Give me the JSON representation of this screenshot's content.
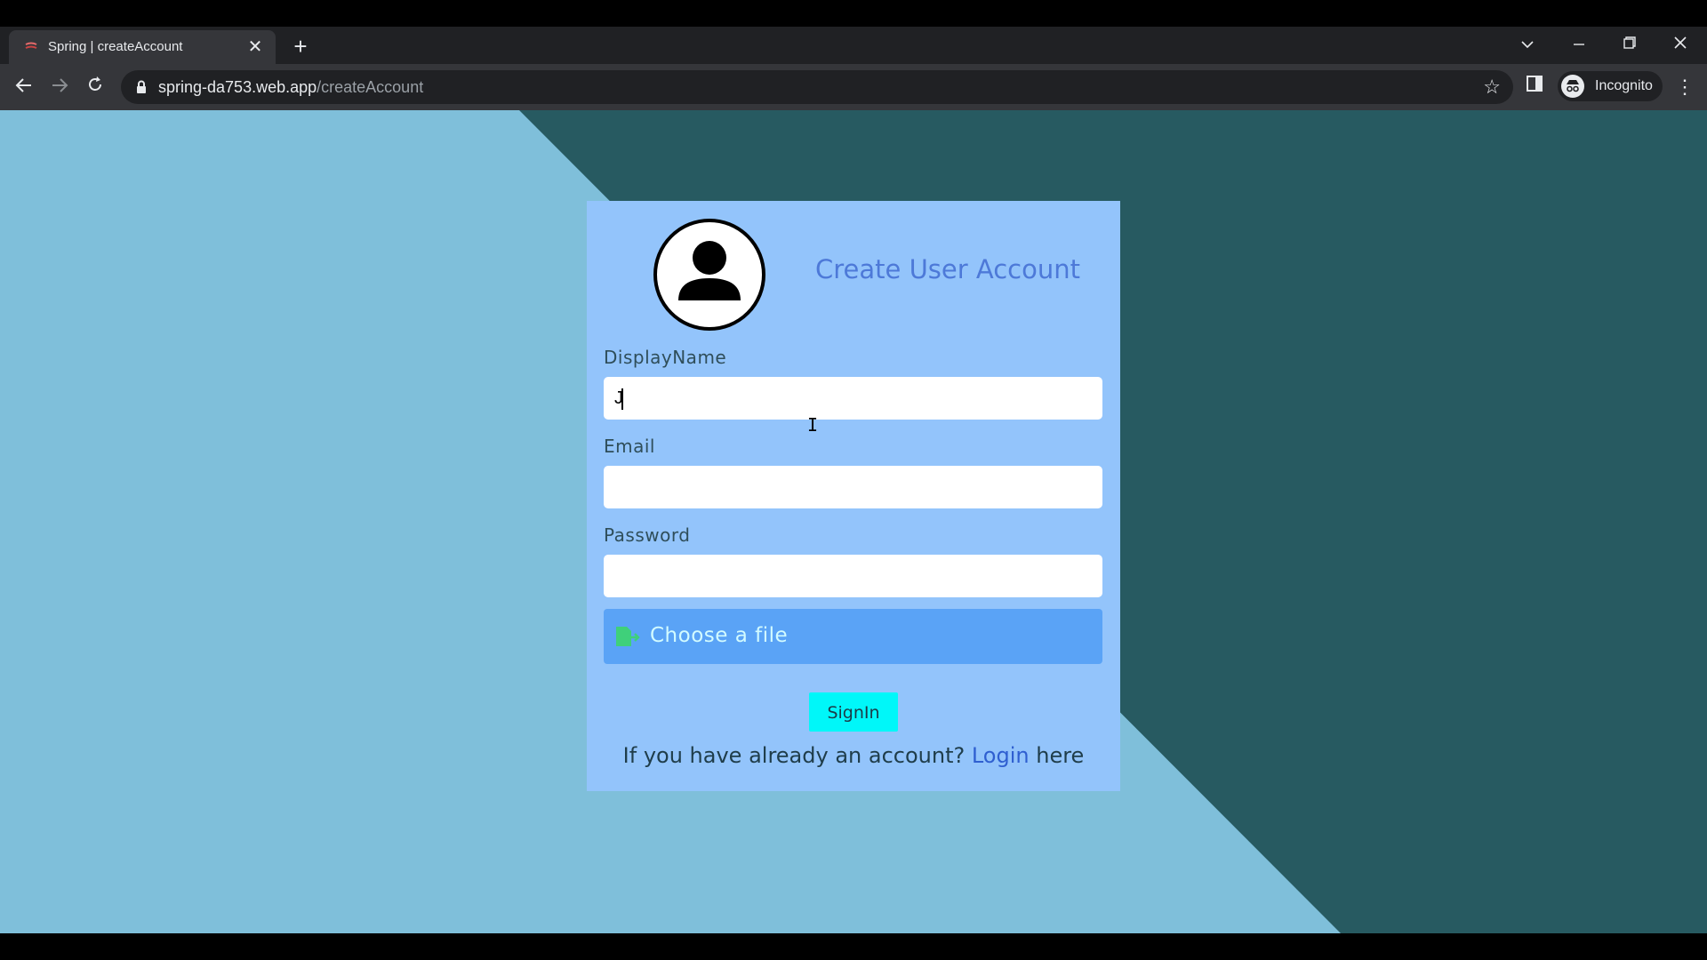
{
  "browser": {
    "tab_title": "Spring | createAccount",
    "url_host": "spring-da753.web.app",
    "url_path": "/createAccount",
    "profile_label": "Incognito"
  },
  "form": {
    "title": "Create User Account",
    "display_name_label": "DisplayName",
    "display_name_value": "J",
    "email_label": "Email",
    "email_value": "",
    "password_label": "Password",
    "password_value": "",
    "file_button_label": "Choose a file",
    "submit_label": "SignIn",
    "footer_prefix": "If you have already an account? ",
    "footer_link": "Login",
    "footer_suffix": " here"
  },
  "colors": {
    "page_light": "#7fbfda",
    "page_dark": "#275a61",
    "card": "#93c4fb",
    "title": "#4d79d8",
    "file_button": "#5aa3f6",
    "submit_button": "#00f7f9",
    "file_icon": "#3fd07a"
  }
}
